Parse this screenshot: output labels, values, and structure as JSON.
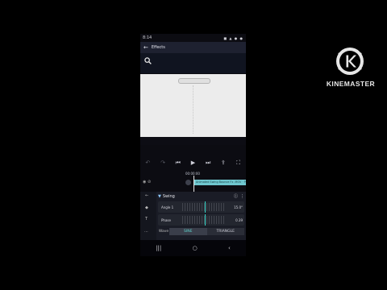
{
  "status_bar": {
    "time": "8:14",
    "icons": "■ ▲ ● ●"
  },
  "header": {
    "back_icon": "arrow-left-icon",
    "title": "Effects"
  },
  "search": {
    "icon": "search-icon"
  },
  "transport": {
    "buttons": [
      "⏮",
      "↺",
      "⏮",
      "▶",
      "⏭",
      "↷",
      "⧉"
    ]
  },
  "timeline": {
    "timecode": "00:00:00",
    "clip_label": "Animated Swing Bounce Fx .MOV · Preview"
  },
  "effect": {
    "name": "Swing"
  },
  "params": [
    {
      "label": "Angle 1",
      "value": "15.0°"
    },
    {
      "label": "Phase",
      "value": "0.39"
    }
  ],
  "wave": {
    "label": "Wave",
    "options": [
      "SINE",
      "TRIANGLE"
    ],
    "selected": "SINE"
  },
  "brand": {
    "name": "KINEMASTER",
    "accent": "#e8e8e8"
  }
}
